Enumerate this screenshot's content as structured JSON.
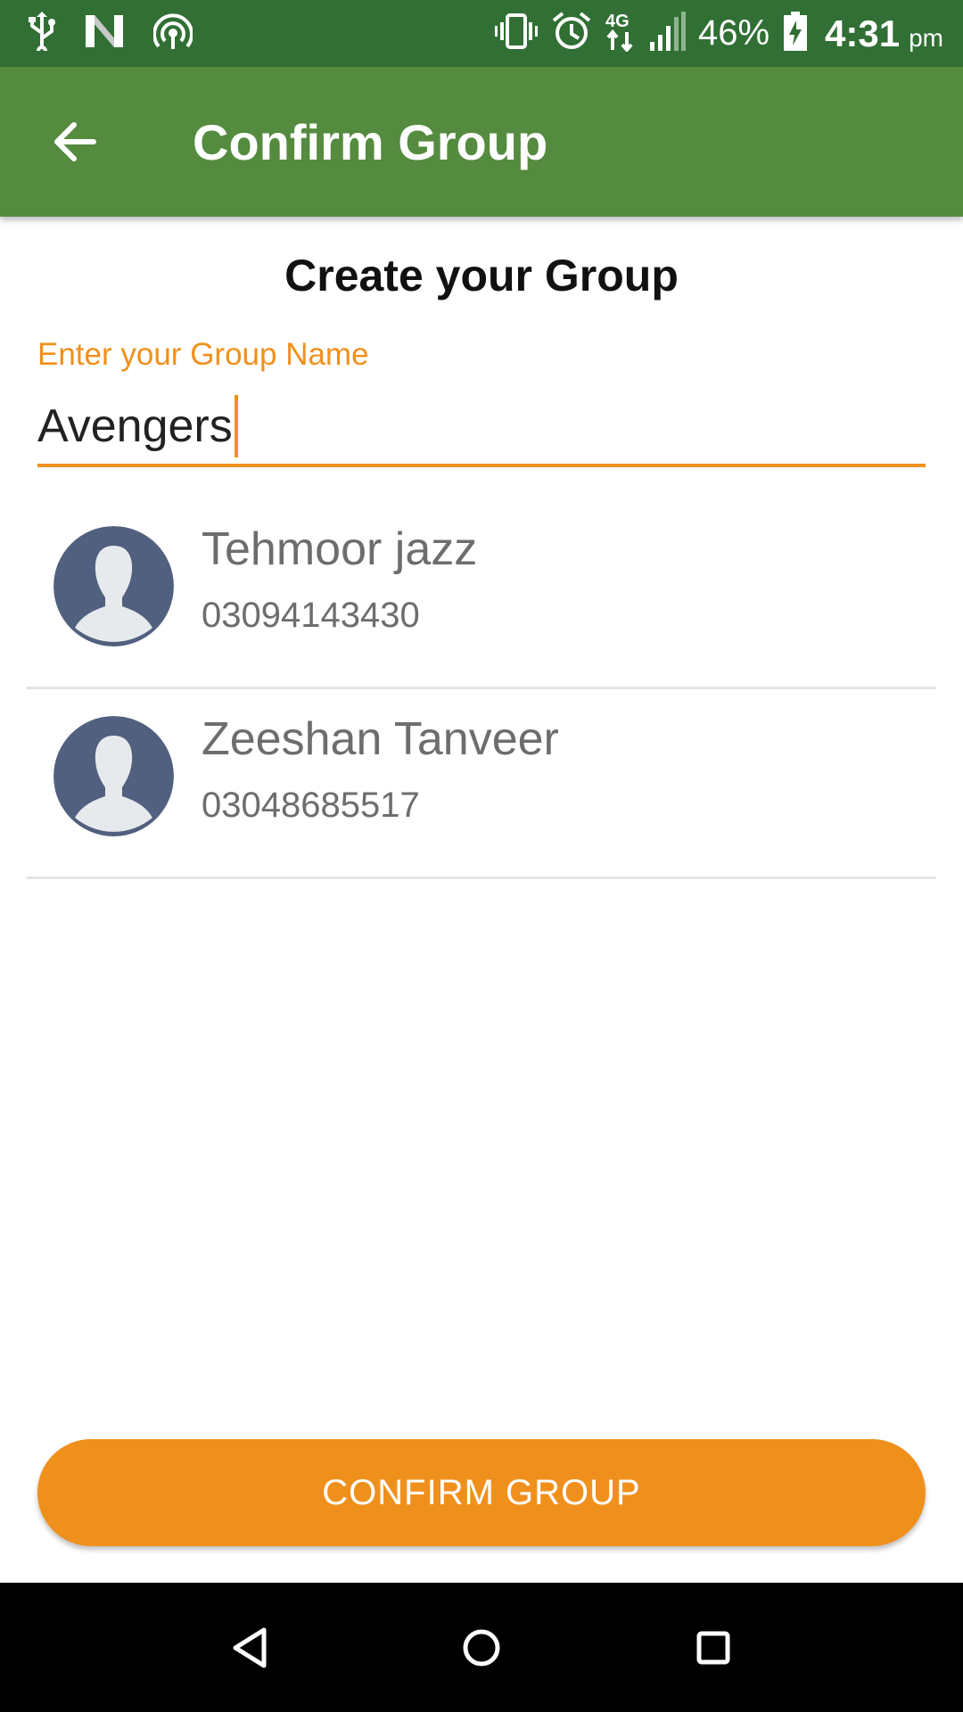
{
  "status_bar": {
    "battery": "46%",
    "time": "4:31",
    "ampm": "pm",
    "icons": [
      "usb-icon",
      "n-icon",
      "hotspot-icon",
      "vibrate-icon",
      "alarm-icon",
      "4g-icon",
      "signal-icon",
      "battery-icon"
    ]
  },
  "app_bar": {
    "title": "Confirm Group",
    "back_icon": "arrow-back-icon"
  },
  "form": {
    "heading": "Create your Group",
    "group_name_label": "Enter your Group Name",
    "group_name_value": "Avengers"
  },
  "contacts": [
    {
      "name": "Tehmoor jazz",
      "phone": "03094143430"
    },
    {
      "name": "Zeeshan Tanveer",
      "phone": "03048685517"
    }
  ],
  "actions": {
    "confirm_label": "CONFIRM GROUP"
  },
  "nav_bar": {
    "icons": [
      "back-triangle-icon",
      "home-circle-icon",
      "recents-square-icon"
    ]
  },
  "colors": {
    "status_bar": "#316f34",
    "app_bar": "#558b3f",
    "accent": "#f0901c",
    "avatar_bg": "#52607f",
    "avatar_figure": "#e6eaed"
  }
}
